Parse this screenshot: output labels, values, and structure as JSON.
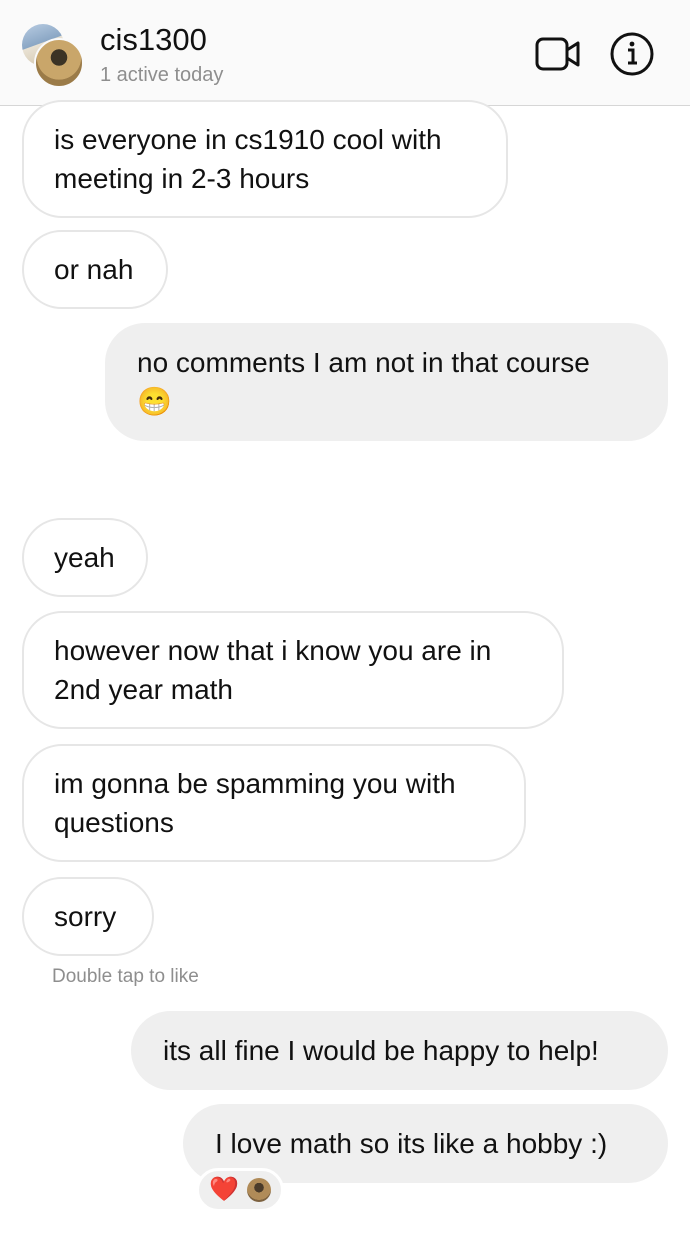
{
  "header": {
    "title": "cis1300",
    "status": "1 active today",
    "video_icon": "video-camera-icon",
    "info_icon": "info-icon"
  },
  "messages": [
    {
      "side": "incoming",
      "text": "is everyone in cs1910 cool with meeting in 2-3 hours"
    },
    {
      "side": "incoming",
      "text": "or nah"
    },
    {
      "side": "outgoing",
      "text": "no comments I am not in that course",
      "emoji": "😁"
    },
    {
      "side": "incoming",
      "text": "yeah"
    },
    {
      "side": "incoming",
      "text": "however now that i know you are in 2nd year math"
    },
    {
      "side": "incoming",
      "text": "im gonna be spamming you with questions"
    },
    {
      "side": "incoming",
      "text": "sorry"
    },
    {
      "side": "outgoing",
      "text": "its all fine I would be happy to help!"
    },
    {
      "side": "outgoing",
      "text": "I love math so its like a hobby :)"
    }
  ],
  "hint": "Double tap to like",
  "reactions": {
    "emoji": "❤️"
  },
  "colors": {
    "incoming_bg": "#ffffff",
    "incoming_border": "#e6e6e6",
    "outgoing_bg": "#efefef",
    "muted": "#8e8e8e"
  }
}
